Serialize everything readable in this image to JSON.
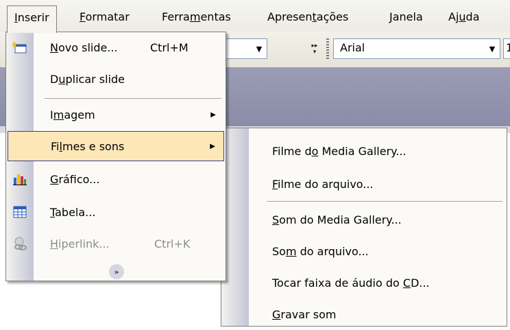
{
  "menubar": {
    "items": [
      {
        "label": "Inserir",
        "u": "I",
        "rest": "nserir"
      },
      {
        "label": "Formatar",
        "u": "F",
        "rest": "ormatar"
      },
      {
        "pre": "Ferra",
        "u": "m",
        "rest": "entas"
      },
      {
        "pre": "Apresen",
        "u": "t",
        "rest": "ações"
      },
      {
        "u": "J",
        "rest": "anela"
      },
      {
        "pre": "Aj",
        "u": "u",
        "rest": "da"
      }
    ]
  },
  "toolbar": {
    "font_name": "Arial",
    "size_partial": "1"
  },
  "insert_menu": {
    "novo_slide": {
      "pre": "",
      "u": "N",
      "rest": "ovo slide...",
      "shortcut": "Ctrl+M"
    },
    "duplicar": {
      "pre": "D",
      "u": "u",
      "rest": "plicar slide"
    },
    "imagem": {
      "pre": "I",
      "u": "m",
      "rest": "agem"
    },
    "filmes": {
      "pre": "Fi",
      "u": "l",
      "rest": "mes e sons"
    },
    "grafico": {
      "pre": "",
      "u": "G",
      "rest": "ráfico..."
    },
    "tabela": {
      "pre": "",
      "u": "T",
      "rest": "abela..."
    },
    "hiperlink": {
      "pre": "",
      "u": "H",
      "rest": "iperlink...",
      "shortcut": "Ctrl+K"
    }
  },
  "media_submenu": {
    "filme_gallery": {
      "pre": "Filme d",
      "u": "o",
      "rest": " Media Gallery..."
    },
    "filme_arquivo": {
      "pre": "",
      "u": "F",
      "rest": "ilme do arquivo..."
    },
    "som_gallery": {
      "pre": "",
      "u": "S",
      "rest": "om do Media Gallery..."
    },
    "som_arquivo": {
      "pre": "So",
      "u": "m",
      "rest": " do arquivo..."
    },
    "tocar_cd": {
      "pre": "Tocar faixa de áudio do ",
      "u": "C",
      "rest": "D..."
    },
    "gravar": {
      "pre": "",
      "u": "G",
      "rest": "ravar som"
    }
  },
  "colors": {
    "highlight": "#fde7b7",
    "highlight_border": "#3b3b96",
    "band": "#9b9db5"
  }
}
